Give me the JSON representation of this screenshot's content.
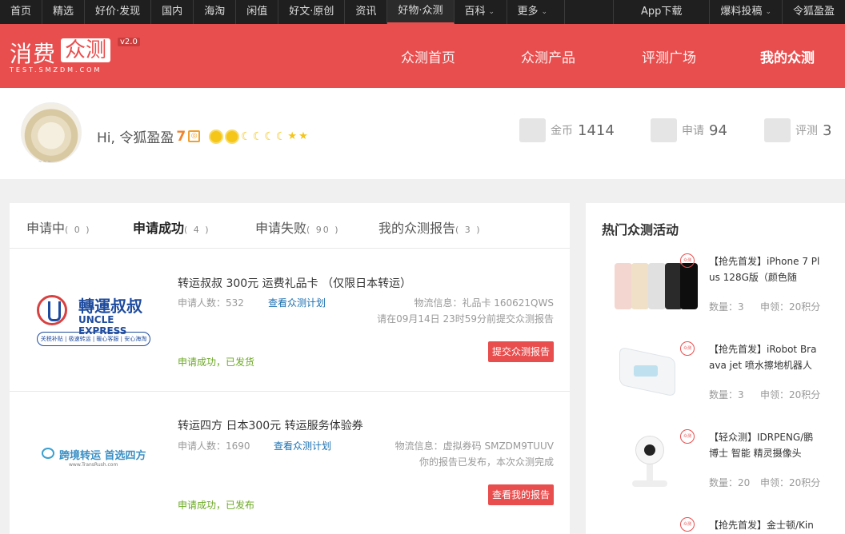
{
  "topnav": {
    "items": [
      "首页",
      "精选",
      "好价·发现",
      "国内",
      "海淘",
      "闲值",
      "好文·原创",
      "资讯",
      "好物·众测",
      "百科",
      "更多"
    ],
    "app_download": "App下载",
    "submit": "爆料投稿",
    "user": "令狐盈盈"
  },
  "header": {
    "logo_left": "消费",
    "logo_box": "众测",
    "version": "v2.0",
    "url": "TEST.SMZDM.COM",
    "nav": [
      "众测首页",
      "众测产品",
      "评测广场",
      "我的众测"
    ]
  },
  "profile": {
    "greeting": "Hi, 令狐盈盈",
    "level": "7",
    "coins_label": "金币",
    "coins": "1414",
    "apply_label": "申请",
    "apply": "94",
    "review_label": "评测",
    "review": "3"
  },
  "tabs": [
    {
      "label": "申请中",
      "count": "( 0 )"
    },
    {
      "label": "申请成功",
      "count": "( 4 )"
    },
    {
      "label": "申请失败",
      "count": "( 90 )"
    },
    {
      "label": "我的众测报告",
      "count": "( 3 )"
    }
  ],
  "rows": [
    {
      "logo_cn": "轉運叔叔",
      "logo_en": "UNCLE EXPRESS",
      "logo_tag": "关税补贴 | 极速转运 | 暖心客服 | 安心海淘",
      "title": "转运叔叔 300元 运费礼品卡 （仅限日本转运）",
      "applicants": "申请人数：532",
      "plan_link": "查看众测计划",
      "logistics": "物流信息：礼品卡 160621QWS",
      "note": "请在09月14日 23时59分前提交众测报告",
      "status": "申请成功，已发货",
      "button": "提交众测报告"
    },
    {
      "logo_cn": "跨境转运 首选四方",
      "logo_url": "www.TransRush.com",
      "title": "转运四方 日本300元 转运服务体验券",
      "applicants": "申请人数：1690",
      "plan_link": "查看众测计划",
      "logistics": "物流信息：虚拟券码 SMZDM9TUUV",
      "note": "你的报告已发布，本次众测完成",
      "status": "申请成功，已发布",
      "button": "查看我的报告"
    }
  ],
  "sidebar": {
    "title": "热门众测活动",
    "stamp": "众测",
    "items": [
      {
        "title": "【抢先首发】iPhone 7 Plus 128G版（颜色随",
        "count": "数量：3",
        "fee": "申领：20积分"
      },
      {
        "title": "【抢先首发】iRobot Braava jet 喷水擦地机器人",
        "count": "数量：3",
        "fee": "申领：20积分"
      },
      {
        "title": "【轻众测】IDRPENG/鹏博士 智能 精灵摄像头",
        "count": "数量：20",
        "fee": "申领：20积分"
      },
      {
        "title": "【抢先首发】金士顿/Kin"
      }
    ]
  }
}
